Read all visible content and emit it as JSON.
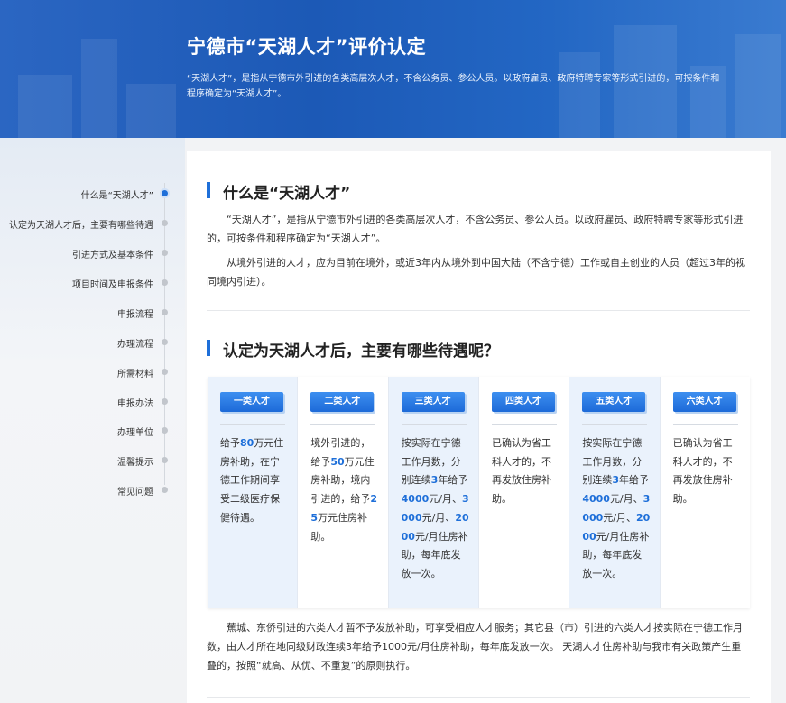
{
  "banner": {
    "title": "宁德市“天湖人才”评价认定",
    "desc": "“天湖人才”，是指从宁德市外引进的各类高层次人才，不含公务员、参公人员。以政府雇员、政府特聘专家等形式引进的，可按条件和程序确定为“天湖人才”。"
  },
  "sidebar": {
    "items": [
      {
        "label": "什么是“天湖人才”"
      },
      {
        "label": "认定为天湖人才后，主要有哪些待遇"
      },
      {
        "label": "引进方式及基本条件"
      },
      {
        "label": "项目时间及申报条件"
      },
      {
        "label": "申报流程"
      },
      {
        "label": "办理流程"
      },
      {
        "label": "所需材料"
      },
      {
        "label": "申报办法"
      },
      {
        "label": "办理单位"
      },
      {
        "label": "温馨提示"
      },
      {
        "label": "常见问题"
      }
    ]
  },
  "section1": {
    "title": "什么是“天湖人才”",
    "p1": "“天湖人才”，是指从宁德市外引进的各类高层次人才，不含公务员、参公人员。以政府雇员、政府特聘专家等形式引进的，可按条件和程序确定为“天湖人才”。",
    "p2": "从境外引进的人才，应为目前在境外，或近3年内从境外到中国大陆（不含宁德）工作或自主创业的人员（超过3年的视同境内引进）。"
  },
  "section2": {
    "title": "认定为天湖人才后，主要有哪些待遇呢？",
    "categories": [
      {
        "badge": "一类人才",
        "parts": [
          "给予",
          "80",
          "万元住房补助，在宁德工作期间享受二级医疗保健待遇。"
        ]
      },
      {
        "badge": "二类人才",
        "parts": [
          "境外引进的，给予",
          "50",
          "万元住房补助，境内引进的，给予",
          "25",
          "万元住房补助。"
        ]
      },
      {
        "badge": "三类人才",
        "parts": [
          "按实际在宁德工作月数，分别连续",
          "3",
          "年给予",
          "4000",
          "元/月、",
          "3000",
          "元/月、",
          "2000",
          "元/月住房补助，每年底发放一次。"
        ]
      },
      {
        "badge": "四类人才",
        "parts": [
          "已确认为省工科人才的，不再发放住房补助。"
        ]
      },
      {
        "badge": "五类人才",
        "parts": [
          "按实际在宁德工作月数，分别连续",
          "3",
          "年给予",
          "4000",
          "元/月、",
          "3000",
          "元/月、",
          "2000",
          "元/月住房补助，每年底发放一次。"
        ]
      },
      {
        "badge": "六类人才",
        "parts": [
          "已确认为省工科人才的，不再发放住房补助。"
        ]
      }
    ],
    "note": [
      "蕉城、东侨引进的六类人才暂不予发放补助，可享受相应人才服务；其它县（市）引进的六类人才按实际在宁德工作月数，由人才所在地同级财政连续",
      "3",
      "年给予",
      "1000",
      "元/月住房补助，每年底发放一次。 天湖人才住房补助与我市有关政策产生重叠的，按照“就高、从优、不重复”的原则执行。"
    ]
  },
  "colors": {
    "accent": "#1e6fd9",
    "banner": "#2563bf"
  },
  "state": {
    "active_nav": 0
  }
}
